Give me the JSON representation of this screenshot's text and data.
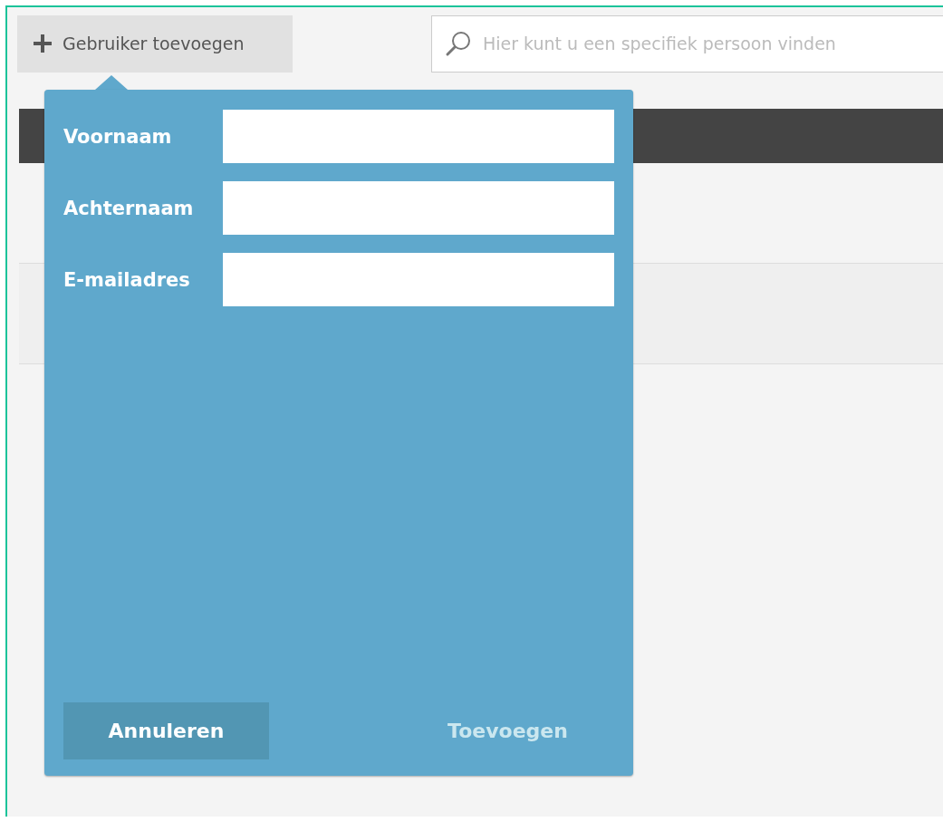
{
  "toolbar": {
    "add_button": "Gebruiker toevoegen",
    "search": {
      "placeholder": "Hier kunt u een specifiek persoon vinden"
    }
  },
  "popup": {
    "fields": [
      {
        "label": "Voornaam"
      },
      {
        "label": "Achternaam"
      },
      {
        "label": "E-mailadres"
      }
    ],
    "buttons": [
      {
        "label": "Annuleren",
        "disabled": false
      },
      {
        "label": "Toevoegen",
        "disabled": true
      }
    ]
  }
}
